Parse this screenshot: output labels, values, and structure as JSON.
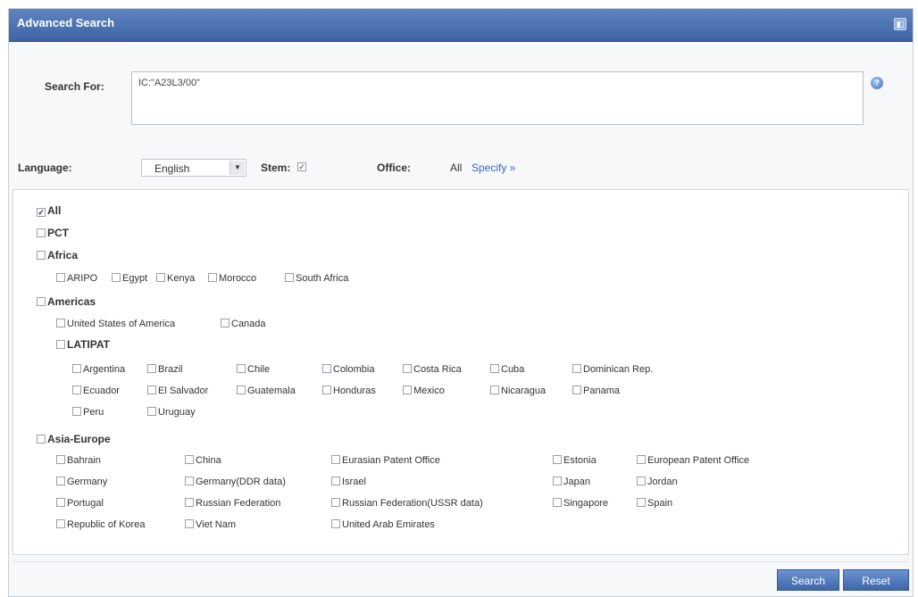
{
  "dialog": {
    "title": "Advanced Search",
    "collapse_icon": "collapse-icon"
  },
  "search": {
    "label": "Search For:",
    "value": "IC:\"A23L3/00\"",
    "help_icon": "help-icon"
  },
  "options": {
    "language_label": "Language:",
    "language_value": "English",
    "stem_label": "Stem:",
    "stem_checked": true,
    "office_label": "Office:",
    "office_value": "All",
    "specify_link": "Specify »"
  },
  "offices": {
    "all": "All",
    "pct": "PCT",
    "africa": {
      "label": "Africa",
      "items": [
        "ARIPO",
        "Egypt",
        "Kenya",
        "Morocco",
        "South Africa"
      ]
    },
    "americas": {
      "label": "Americas",
      "items": [
        "United States of America",
        "Canada"
      ],
      "latipat": {
        "label": "LATIPAT",
        "items": [
          "Argentina",
          "Brazil",
          "Chile",
          "Colombia",
          "Costa Rica",
          "Cuba",
          "Dominican Rep.",
          "Ecuador",
          "El Salvador",
          "Guatemala",
          "Honduras",
          "Mexico",
          "Nicaragua",
          "Panama",
          "Peru",
          "Uruguay"
        ]
      }
    },
    "asia_europe": {
      "label": "Asia-Europe",
      "items": [
        "Bahrain",
        "China",
        "Eurasian Patent Office",
        "Estonia",
        "European Patent Office",
        "Germany",
        "Germany(DDR data)",
        "Israel",
        "Japan",
        "Jordan",
        "Portugal",
        "Russian Federation",
        "Russian Federation(USSR data)",
        "Singapore",
        "Spain",
        "Republic of Korea",
        "Viet Nam",
        "United Arab Emirates"
      ]
    }
  },
  "buttons": {
    "search": "Search",
    "reset": "Reset"
  }
}
